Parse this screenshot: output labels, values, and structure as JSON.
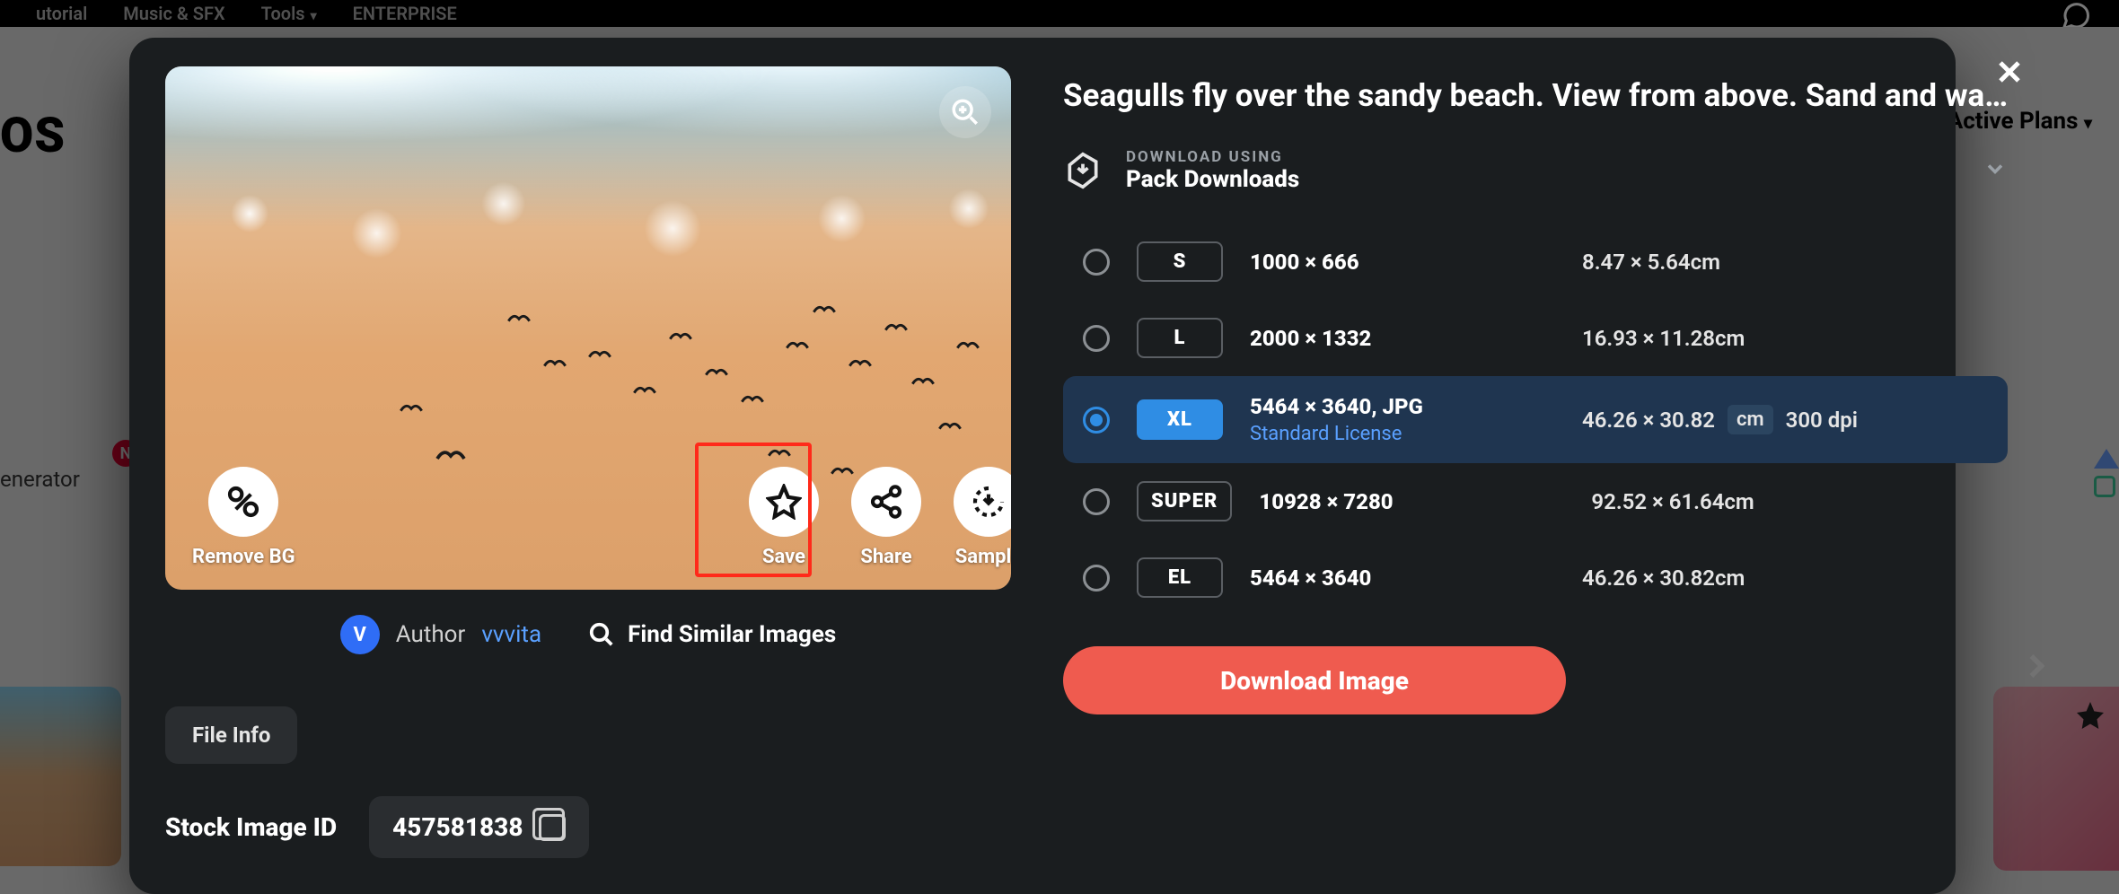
{
  "nav": {
    "items": [
      "utorial",
      "Music & SFX",
      "Tools",
      "ENTERPRISE"
    ],
    "active_plans": "Active Plans"
  },
  "bg": {
    "logo_fragment": "OS",
    "generator_fragment": "enerator",
    "badge_letter": "N"
  },
  "modal": {
    "title": "Seagulls fly over the sandy beach. View from above. Sand and wa…",
    "download_using": {
      "label_small": "DOWNLOAD USING",
      "label_big": "Pack Downloads"
    },
    "sizes": [
      {
        "code": "S",
        "dims": "1000 × 666",
        "phys": "8.47 × 5.64cm",
        "selected": false
      },
      {
        "code": "L",
        "dims": "2000 × 1332",
        "phys": "16.93 × 11.28cm",
        "selected": false
      },
      {
        "code": "XL",
        "dims": "5464 × 3640, JPG",
        "phys": "46.26 × 30.82",
        "unit": "cm",
        "dpi": "300 dpi",
        "license": "Standard License",
        "selected": true
      },
      {
        "code": "SUPER",
        "dims": "10928 × 7280",
        "phys": "92.52 × 61.64cm",
        "selected": false
      },
      {
        "code": "EL",
        "dims": "5464 × 3640",
        "phys": "46.26 × 30.82cm",
        "selected": false
      }
    ],
    "download_btn": "Download Image",
    "actions": {
      "remove_bg": "Remove BG",
      "save": "Save",
      "share": "Share",
      "sample": "Sample"
    },
    "author": {
      "avatar_initial": "V",
      "label": "Author",
      "name": "vvvita",
      "find_similar": "Find Similar Images"
    },
    "file_info_btn": "File Info",
    "stock_id_label": "Stock Image ID",
    "stock_id_value": "457581838"
  }
}
